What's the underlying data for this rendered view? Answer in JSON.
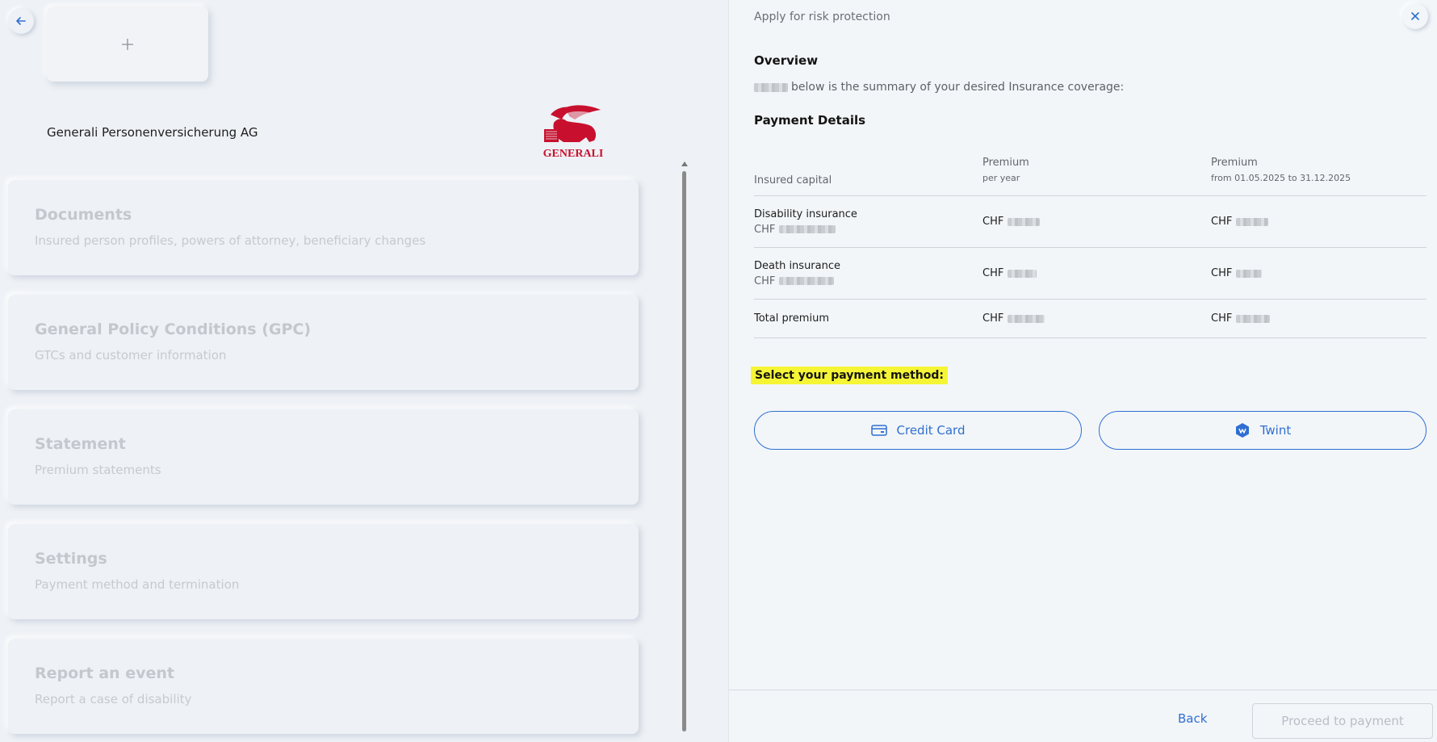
{
  "left": {
    "company_name": "Generali Personenversicherung AG",
    "logo_text": "GENERALI",
    "sections": [
      {
        "title": "Documents",
        "subtitle": "Insured person profiles, powers of attorney, beneficiary changes"
      },
      {
        "title": "General Policy Conditions (GPC)",
        "subtitle": "GTCs and customer information"
      },
      {
        "title": "Statement",
        "subtitle": "Premium statements"
      },
      {
        "title": "Settings",
        "subtitle": "Payment method and termination"
      },
      {
        "title": "Report an event",
        "subtitle": "Report a case of disability"
      }
    ]
  },
  "dialog": {
    "title": "Apply for risk protection",
    "overview_heading": "Overview",
    "summary_text": "below is the summary of your desired Insurance coverage:",
    "payment_details_heading": "Payment Details",
    "table": {
      "col1_header": "Insured capital",
      "col2_header": "Premium",
      "col2_sub": "per year",
      "col3_header": "Premium",
      "col3_sub": "from 01.05.2025 to 31.12.2025",
      "rows": [
        {
          "label": "Disability insurance",
          "capital_currency": "CHF",
          "col2_currency": "CHF",
          "col3_currency": "CHF"
        },
        {
          "label": "Death insurance",
          "capital_currency": "CHF",
          "col2_currency": "CHF",
          "col3_currency": "CHF"
        },
        {
          "label": "Total premium",
          "col2_currency": "CHF",
          "col3_currency": "CHF"
        }
      ]
    },
    "select_method_label": "Select your payment method:",
    "credit_card_label": "Credit Card",
    "twint_label": "Twint",
    "back_label": "Back",
    "proceed_label": "Proceed to payment"
  },
  "colors": {
    "accent": "#2f6fd1",
    "highlight": "#f5f536",
    "logo_red": "#c8102e"
  }
}
